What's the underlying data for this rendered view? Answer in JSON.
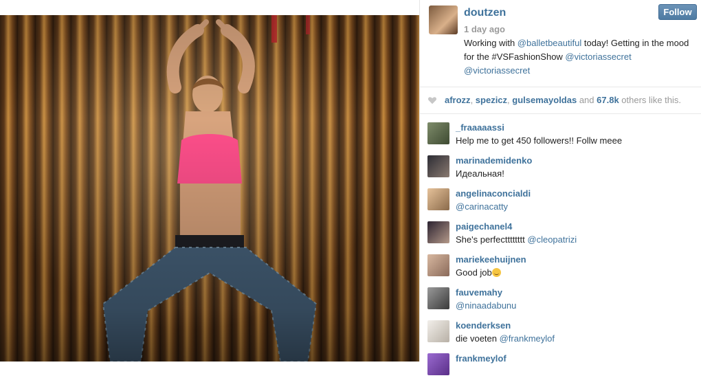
{
  "post": {
    "owner": "doutzen",
    "follow_label": "Follow",
    "timestamp": "1 day ago",
    "caption": {
      "t1": "Working with ",
      "m1": "@balletbeautiful",
      "t2": " today! Getting in the mood for the #VSFashionShow ",
      "m2": "@victoriassecret",
      "m3": "@victoriassecret"
    }
  },
  "likes": {
    "u1": "afrozz",
    "sep1": ", ",
    "u2": "spezicz",
    "sep2": ", ",
    "u3": "gulsemayoldas",
    "and": " and ",
    "count": "67.8k",
    "suffix": " others like this."
  },
  "comments": [
    {
      "user": "_fraaaaassi",
      "text": "Help me to get 450 followers!! Follw meee",
      "mention": "",
      "avatar_color": "#4a5b3c"
    },
    {
      "user": "marinademidenko",
      "text": "Идеальная!",
      "mention": "",
      "avatar_color": "#3b3b40"
    },
    {
      "user": "angelinaconcialdi",
      "text": "",
      "mention": "@carinacatty",
      "avatar_color": "#c29a6b"
    },
    {
      "user": "paigechanel4",
      "text": "She's perfectttttttt ",
      "mention": "@cleopatrizi",
      "avatar_color": "#6e5a4e"
    },
    {
      "user": "mariekeehuijnen",
      "text": "Good job",
      "mention": "",
      "avatar_color": "#c8a890"
    },
    {
      "user": "fauvemahy",
      "text": "",
      "mention": "@ninaadabunu",
      "avatar_color": "#6c6c6c"
    },
    {
      "user": "koenderksen",
      "text": "die voeten ",
      "mention": "@frankmeylof",
      "avatar_color": "#e9e6e2"
    },
    {
      "user": "frankmeylof",
      "text": "",
      "mention": "",
      "avatar_color": "#7a4fa8"
    }
  ],
  "colors": {
    "link": "#3f729b",
    "follow_button": "#4f7ba3",
    "muted": "#999999"
  },
  "icons": {
    "like": "heart-icon",
    "emoji": "smiley-emoji-icon"
  }
}
